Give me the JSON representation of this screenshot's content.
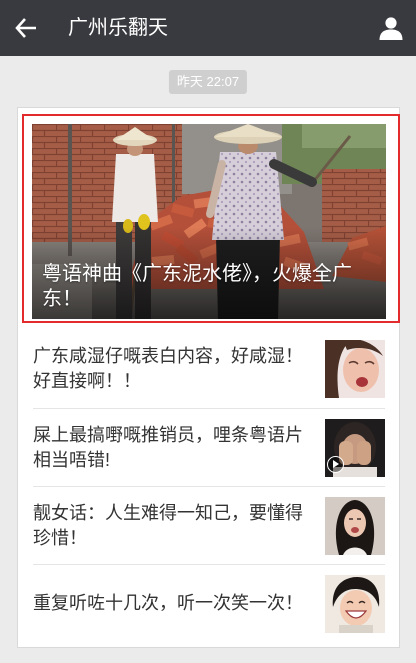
{
  "header": {
    "title": "广州乐翻天",
    "back_icon": "back-arrow-icon",
    "profile_icon": "person-icon"
  },
  "timestamp": "昨天 22:07",
  "articles": {
    "cover": {
      "title": "粤语神曲《广东泥水佬》，火爆全广东！"
    },
    "items": [
      {
        "title": "广东咸湿仔嘅表白内容，好咸湿！好直接啊！！"
      },
      {
        "title": "屎上最搞嘢嘅推销员，哩条粤语片相当唔错!",
        "icon": "play-icon"
      },
      {
        "title": "靓女话：人生难得一知己，要懂得珍惜！"
      },
      {
        "title": "重复听咗十几次，听一次笑一次！"
      }
    ]
  },
  "colors": {
    "header_bg": "#393a3f",
    "page_bg": "#ebebeb",
    "highlight": "#e32b2d",
    "article_text": "#333333",
    "timestamp_bg": "#cfcfcf"
  }
}
